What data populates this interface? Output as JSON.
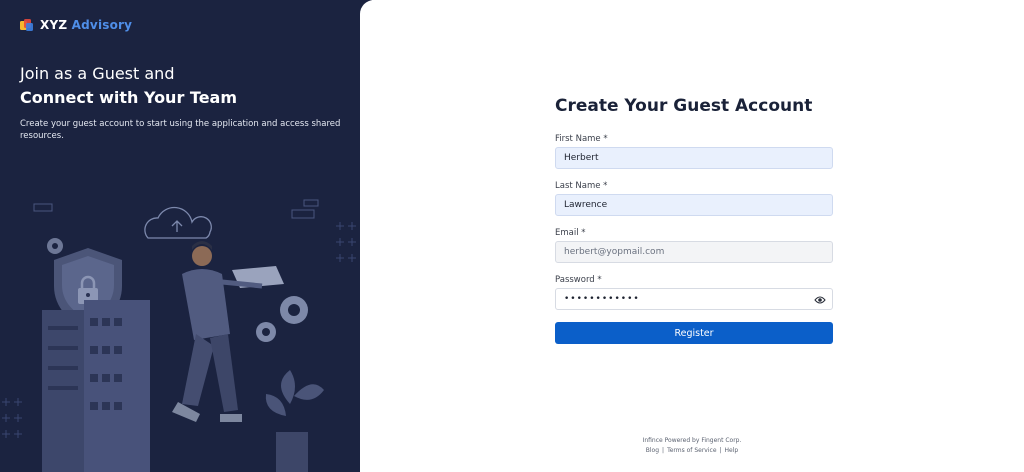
{
  "brand": {
    "name": "XYZ",
    "name_accent": "Advisory"
  },
  "hero": {
    "line1": "Join as a Guest and",
    "line2": "Connect with Your Team",
    "description": "Create your guest account to start using the application and access shared resources."
  },
  "form": {
    "title": "Create Your Guest Account",
    "first_name": {
      "label": "First Name *",
      "value": "Herbert"
    },
    "last_name": {
      "label": "Last Name *",
      "value": "Lawrence"
    },
    "email": {
      "label": "Email *",
      "value": "herbert@yopmail.com"
    },
    "password": {
      "label": "Password *",
      "value": "••••••••••••"
    },
    "submit_label": "Register"
  },
  "footer": {
    "powered_by": "Infince Powered by Fingent Corp.",
    "links": [
      "Blog",
      "Terms of Service",
      "Help"
    ]
  },
  "colors": {
    "left_bg": "#1b2340",
    "primary": "#0b5fc9",
    "accent": "#4f8ee8",
    "filled_input": "#e9f0fd"
  },
  "icons": [
    "logo-mark-icon",
    "cloud-upload-icon",
    "shield-lock-icon",
    "gear-icon",
    "eye-icon"
  ]
}
